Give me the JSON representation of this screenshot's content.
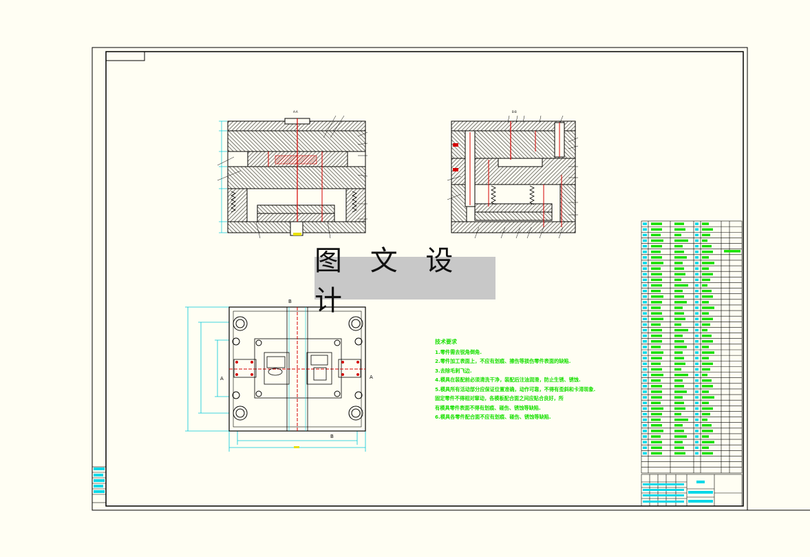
{
  "watermark": {
    "text": "图 文 设 计"
  },
  "tech_requirements": {
    "title": "技术要求",
    "items": [
      "1.零件需去锐角倒角.",
      "2.零件加工表面上，不应有划痕、擦伤等损伤零件表面的缺陷.",
      "3.去除毛刺飞边.",
      "4.模具在装配前必须清洗干净，装配后注油润滑，防止生锈、锈蚀.",
      "5.模具所有活动部分应保证位置准确，动作可靠，不得有歪斜和卡滞现象.",
      "  固定零件不得相对窜动，各模板配合面之间应贴合良好，所",
      "有模具零件表面不得有划痕、碰伤、锈蚀等缺陷.",
      "6.模具各零件配合面不应有划痕、碰伤、锈蚀等缺陷."
    ]
  },
  "section_labels": {
    "section_aa": "A-A",
    "section_bb": "B-B",
    "cut_a": "A",
    "cut_b": "B"
  },
  "colors": {
    "background": "#fffef3",
    "line": "#000000",
    "hatch": "#555555",
    "dimension": "#00c8d8",
    "highlight": "#17e000",
    "section": "#d40000",
    "watermark_bg": "#c8c8c8"
  }
}
